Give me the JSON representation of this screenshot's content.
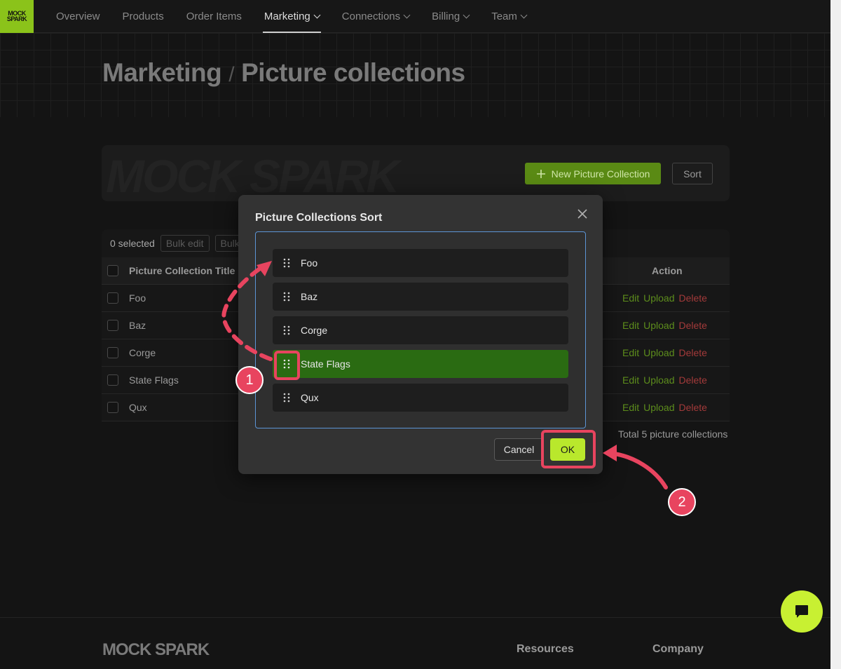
{
  "app": {
    "logo_text": "MOCK SPARK",
    "nav": [
      {
        "label": "Overview",
        "has_dropdown": false,
        "active": false
      },
      {
        "label": "Products",
        "has_dropdown": false,
        "active": false
      },
      {
        "label": "Order Items",
        "has_dropdown": false,
        "active": false
      },
      {
        "label": "Marketing",
        "has_dropdown": true,
        "active": true
      },
      {
        "label": "Connections",
        "has_dropdown": true,
        "active": false
      },
      {
        "label": "Billing",
        "has_dropdown": true,
        "active": false
      },
      {
        "label": "Team",
        "has_dropdown": true,
        "active": false
      }
    ]
  },
  "breadcrumb": {
    "section": "Marketing",
    "separator": "/",
    "page": "Picture collections"
  },
  "toolbar": {
    "new_label": "New Picture Collection",
    "sort_label": "Sort",
    "watermark": "MOCK SPARK"
  },
  "table": {
    "selected_label": "0 selected",
    "bulk_edit_label": "Bulk edit",
    "bulk_label_2": "Bulk",
    "col_title": "Picture Collection Title",
    "col_action": "Action",
    "rows": [
      {
        "title": "Foo"
      },
      {
        "title": "Baz"
      },
      {
        "title": "Corge"
      },
      {
        "title": "State Flags"
      },
      {
        "title": "Qux"
      }
    ],
    "action_edit": "Edit",
    "action_upload": "Upload",
    "action_delete": "Delete",
    "total_label": "Total 5 picture collections"
  },
  "modal": {
    "title": "Picture Collections Sort",
    "items": [
      "Foo",
      "Baz",
      "Corge",
      "State Flags",
      "Qux"
    ],
    "active_item": "State Flags",
    "cancel_label": "Cancel",
    "ok_label": "OK"
  },
  "footer": {
    "logo_text": "MOCK SPARK",
    "col1": "Resources",
    "col2": "Company"
  },
  "annotations": {
    "step1": "1",
    "step2": "2"
  },
  "colors": {
    "accent": "#b9e82c",
    "annotation": "#e8445f",
    "drag_active": "#2a6b12",
    "focus_border": "#5c95d6"
  }
}
